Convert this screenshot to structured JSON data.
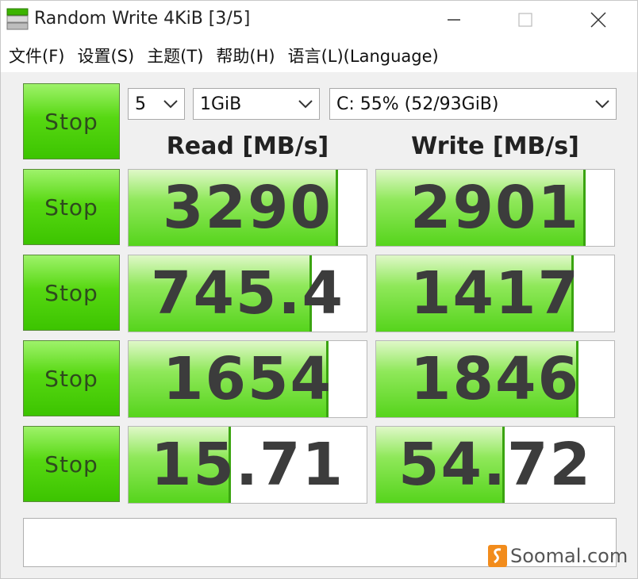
{
  "window": {
    "title": "Random Write 4KiB [3/5]"
  },
  "menu": {
    "items": [
      {
        "label": "文件(F)"
      },
      {
        "label": "设置(S)"
      },
      {
        "label": "主题(T)"
      },
      {
        "label": "帮助(H)"
      },
      {
        "label": "语言(L)(Language)"
      }
    ]
  },
  "controls": {
    "count": "5",
    "size": "1GiB",
    "drive": "C: 55% (52/93GiB)"
  },
  "headers": {
    "read": "Read [MB/s]",
    "write": "Write [MB/s]"
  },
  "stop_label": "Stop",
  "rows": [
    {
      "read": "3290",
      "read_fill": 0.88,
      "write": "2901",
      "write_fill": 0.88
    },
    {
      "read": "745.4",
      "read_fill": 0.77,
      "write": "1417",
      "write_fill": 0.83
    },
    {
      "read": "1654",
      "read_fill": 0.84,
      "write": "1846",
      "write_fill": 0.85
    },
    {
      "read": "15.71",
      "read_fill": 0.43,
      "write": "54.72",
      "write_fill": 0.54
    }
  ],
  "comment": "",
  "watermark": "Soomal.com",
  "colors": {
    "button_green": "#57d812",
    "fill_green": "#56d41c",
    "value_text": "#3c3c3c"
  }
}
